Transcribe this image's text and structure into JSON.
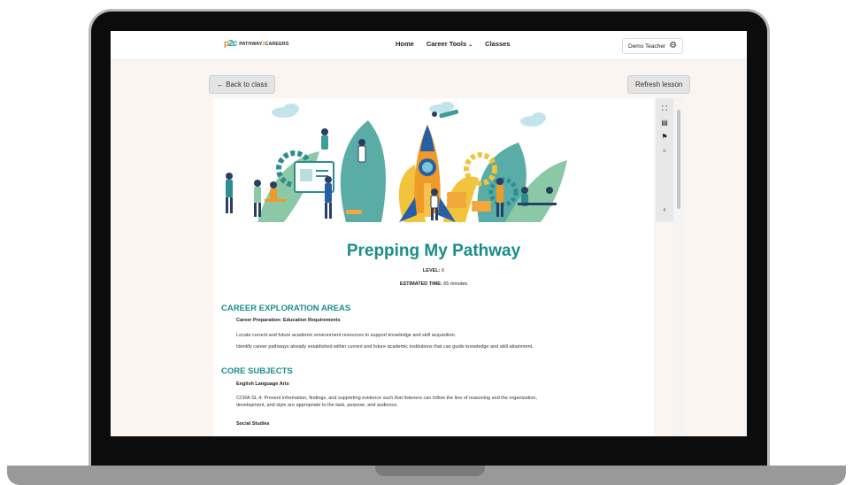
{
  "nav": {
    "logo_mark_p": "p",
    "logo_mark_2c": "2c",
    "logo_word1": "PATHWAY",
    "logo_word2": "2",
    "logo_word3": "CAREERS",
    "links": [
      "Home",
      "Career Tools",
      "Classes"
    ],
    "career_tools_caret": "⌄",
    "user_label": "Demo Teacher",
    "user_icon": "gear-icon"
  },
  "toolbar": {
    "back_label": "← Back to class",
    "refresh_label": "Refresh lesson"
  },
  "side_tools": {
    "icons": [
      "expand-icon",
      "notes-icon",
      "flag-icon",
      "text-icon",
      "collapse-chevron-icon"
    ],
    "glyphs": [
      "⛶",
      "▤",
      "⚑",
      "≡",
      "‹"
    ]
  },
  "lesson": {
    "title": "Prepping My Pathway",
    "level_label": "LEVEL:",
    "level_value": "6",
    "time_label": "ESTIMATED TIME:",
    "time_value": "65 minutes",
    "sections": [
      {
        "heading": "CAREER EXPLORATION AREAS",
        "subheading": "Career Preparation: Education Requirements",
        "paragraphs": [
          "Locate current and future academic environment resources to support knowledge and skill acquisition.",
          "Identify career pathways already established within current and future academic institutions that can guide knowledge and skill attainment."
        ]
      },
      {
        "heading": "CORE SUBJECTS",
        "subheading": "English Language Arts",
        "paragraphs": [
          "CCRA.SL.4: Present information, findings, and supporting evidence such that listeners can follow the line of reasoning and the organization, development, and style are appropriate to the task, purpose, and audience."
        ]
      }
    ],
    "next_subheading": "Social Studies"
  },
  "colors": {
    "accent": "#1a8d8a",
    "brand_orange": "#e5852c",
    "page_bg": "#fbf5f1"
  }
}
